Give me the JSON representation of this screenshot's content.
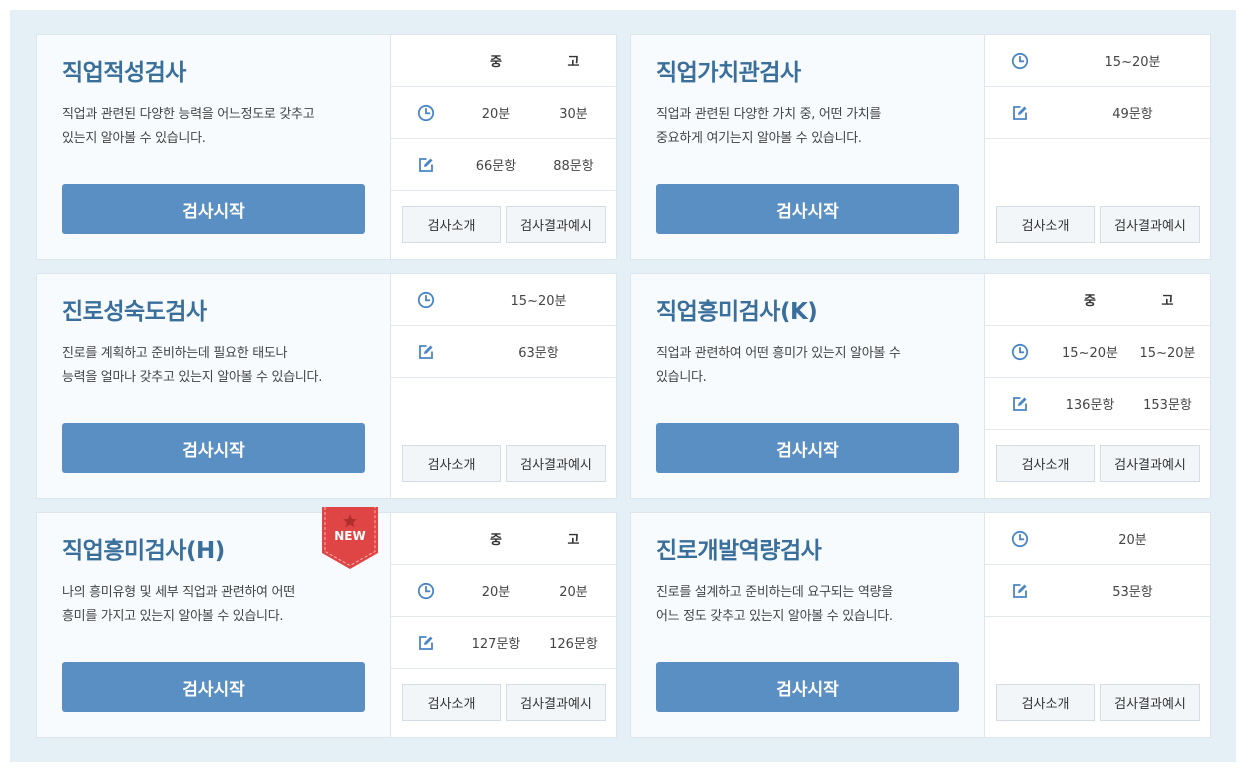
{
  "common": {
    "start_label": "검사시작",
    "intro_label": "검사소개",
    "result_label": "검사결과예시"
  },
  "cards": [
    {
      "title": "직업적성검사",
      "desc_line1": "직업과 관련된 다양한 능력을 어느정도로 갖추고",
      "desc_line2": "있는지 알아볼 수 있습니다.",
      "header_middle": "중",
      "header_high": "고",
      "time_middle": "20분",
      "time_high": "30분",
      "items_middle": "66문항",
      "items_high": "88문항"
    },
    {
      "title": "직업가치관검사",
      "desc_line1": "직업과 관련된 다양한 가치 중, 어떤 가치를",
      "desc_line2": "중요하게 여기는지 알아볼 수 있습니다.",
      "time": "15~20분",
      "items": "49문항"
    },
    {
      "title": "진로성숙도검사",
      "desc_line1": "진로를 계획하고 준비하는데 필요한 태도나",
      "desc_line2": "능력을 얼마나 갖추고 있는지 알아볼 수 있습니다.",
      "time": "15~20분",
      "items": "63문항"
    },
    {
      "title": "직업흥미검사(K)",
      "desc_line1": "직업과 관련하여 어떤 흥미가 있는지 알아볼 수",
      "desc_line2": "있습니다.",
      "header_middle": "중",
      "header_high": "고",
      "time_middle": "15~20분",
      "time_high": "15~20분",
      "items_middle": "136문항",
      "items_high": "153문항"
    },
    {
      "title": "직업흥미검사(H)",
      "badge": "NEW",
      "desc_line1": "나의 흥미유형 및 세부 직업과 관련하여 어떤",
      "desc_line2": "흥미를 가지고 있는지 알아볼 수 있습니다.",
      "header_middle": "중",
      "header_high": "고",
      "time_middle": "20분",
      "time_high": "20분",
      "items_middle": "127문항",
      "items_high": "126문항"
    },
    {
      "title": "진로개발역량검사",
      "desc_line1": "진로를 설계하고 준비하는데 요구되는 역량을",
      "desc_line2": "어느 정도 갖추고 있는지 알아볼 수 있습니다.",
      "time": "20분",
      "items": "53문항"
    }
  ],
  "icons": {
    "time": "clock-icon",
    "items": "edit-icon",
    "badge": "star-icon"
  },
  "colors": {
    "accent": "#5a8fc4",
    "title": "#3a6f9c",
    "icon": "#4a86c5",
    "badge": "#e04545",
    "background": "#e4f0f5"
  }
}
